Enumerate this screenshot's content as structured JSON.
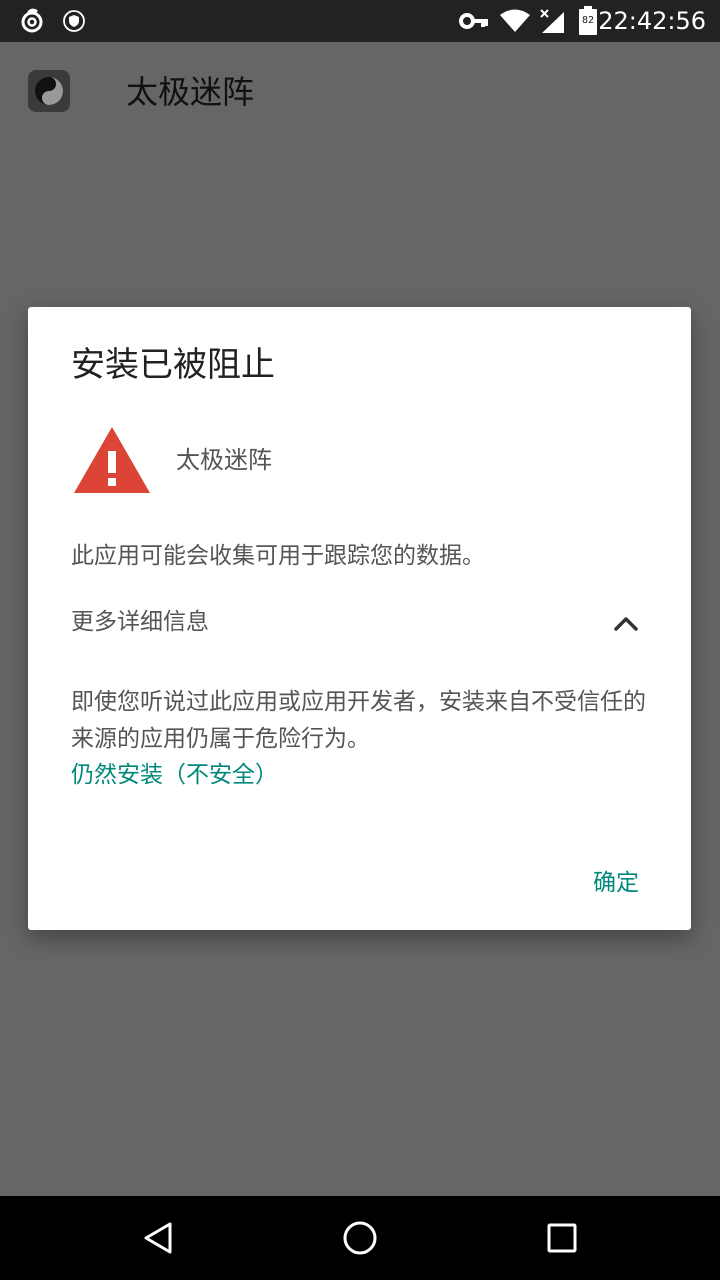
{
  "status_bar": {
    "time": "22:42:56",
    "battery": "82",
    "icons": [
      "netease-cloud-music-icon",
      "shield-icon",
      "vpn-key-icon",
      "wifi-icon",
      "signal-icon",
      "battery-icon"
    ]
  },
  "app_bar": {
    "title": "太极迷阵",
    "icon": "taiji-yin-yang-icon"
  },
  "dialog": {
    "title": "安装已被阻止",
    "warning_icon": "warning-triangle-icon",
    "app_name": "太极迷阵",
    "tracking_message": "此应用可能会收集可用于跟踪您的数据。",
    "details_label": "更多详细信息",
    "details_expanded": true,
    "warning_text": "即使您听说过此应用或应用开发者，安装来自不受信任的来源的应用仍属于危险行为。",
    "install_anyway_label": "仍然安装（不安全）",
    "ok_label": "确定"
  },
  "nav_bar": {
    "icons": [
      "back-icon",
      "home-icon",
      "recents-icon"
    ]
  },
  "colors": {
    "accent": "#00897b",
    "warning": "#db4437",
    "scrim": "#666666",
    "status_bar": "#222222"
  }
}
